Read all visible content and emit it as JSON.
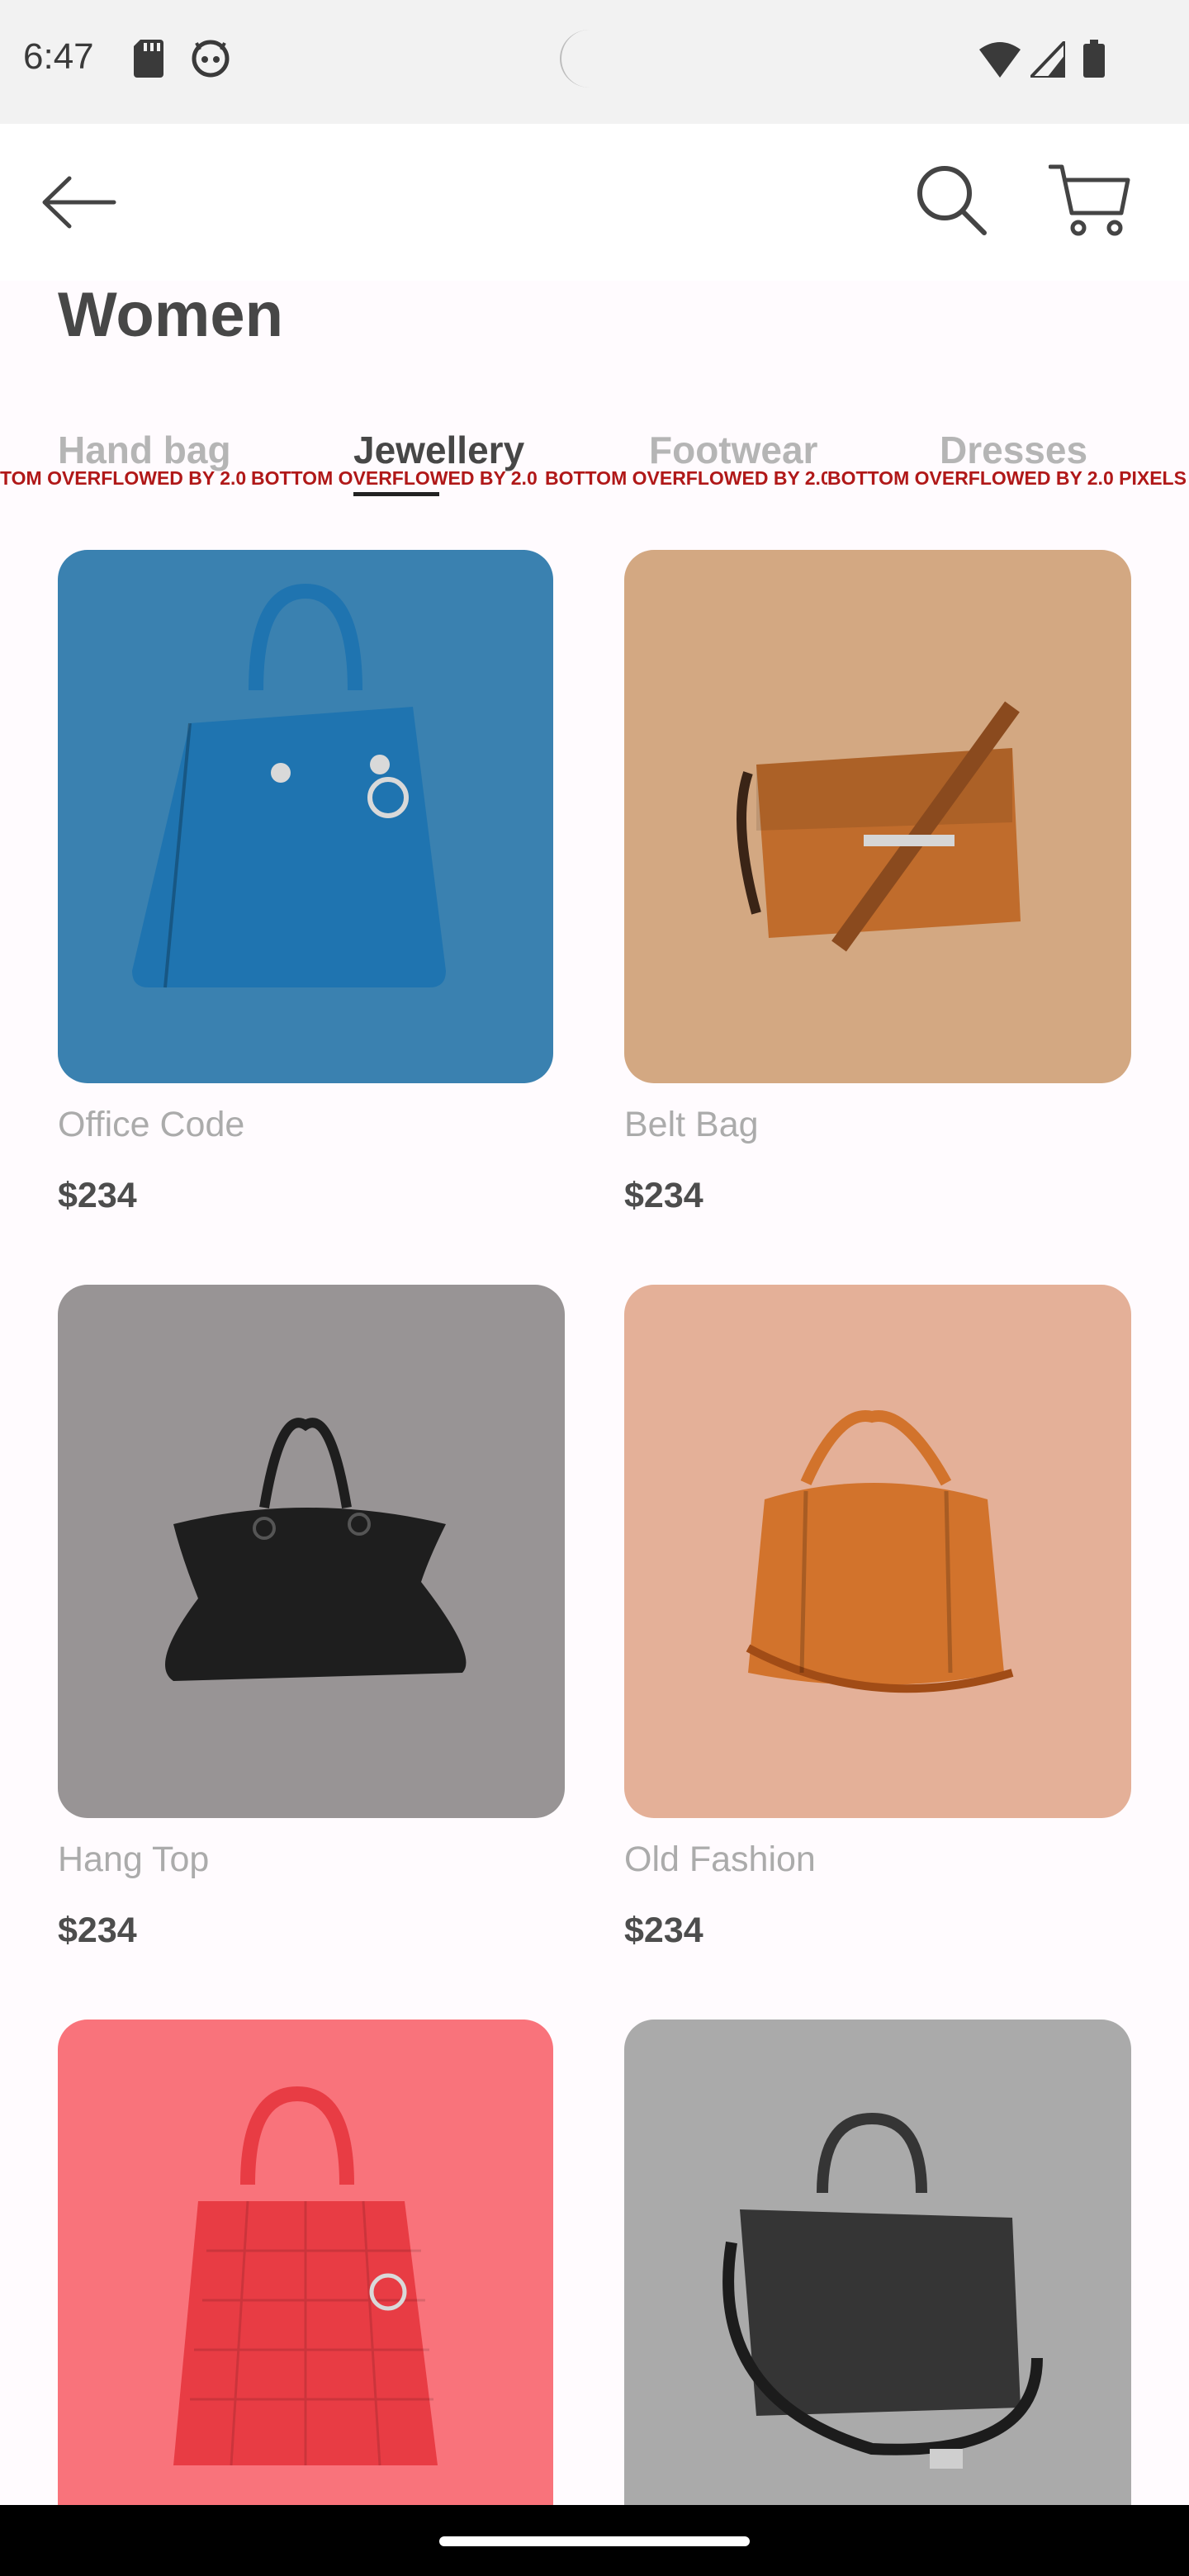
{
  "status_bar": {
    "time": "6:47"
  },
  "page": {
    "title": "Women"
  },
  "tabs": [
    {
      "label": "Hand bag",
      "active": false
    },
    {
      "label": "Jewellery",
      "active": true
    },
    {
      "label": "Footwear",
      "active": false
    },
    {
      "label": "Dresses",
      "active": false
    }
  ],
  "overflow_warnings": [
    "TOM OVERFLOWED BY 2.0",
    "BOTTOM OVERFLOWED BY 2.0",
    "BOTTOM OVERFLOWED BY 2.0",
    "BOTTOM OVERFLOWED BY 2.0 PIXELS"
  ],
  "products": [
    {
      "name": "Office Code",
      "price": "$234",
      "bg_color": "#3a81b0",
      "bag_color": "#1f74b0"
    },
    {
      "name": "Belt Bag",
      "price": "$234",
      "bg_color": "#d3a882",
      "bag_color": "#c06c2c"
    },
    {
      "name": "Hang Top",
      "price": "$234",
      "bg_color": "#989495",
      "bag_color": "#1e1e1e"
    },
    {
      "name": "Old Fashion",
      "price": "$234",
      "bg_color": "#e4b098",
      "bag_color": "#d2732c"
    },
    {
      "name": "",
      "price": "",
      "bg_color": "#f9737b",
      "bag_color": "#e83c44"
    },
    {
      "name": "",
      "price": "",
      "bg_color": "#aaaaaa",
      "bag_color": "#353535"
    }
  ]
}
